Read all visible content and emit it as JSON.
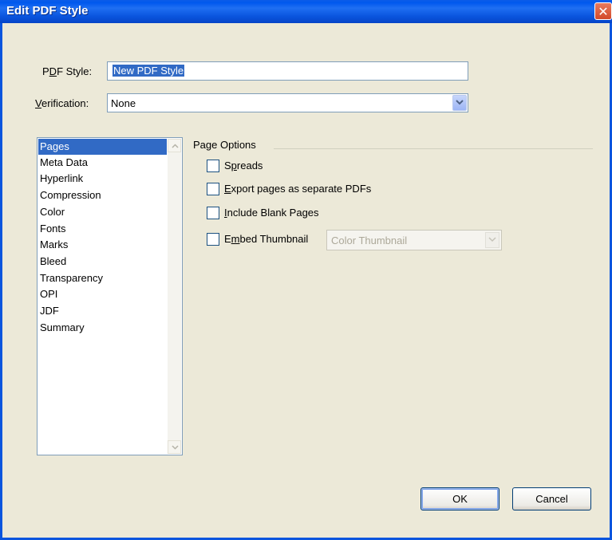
{
  "window": {
    "title": "Edit PDF Style",
    "close_glyph": "✕"
  },
  "pdf_style": {
    "label_prefix": "P",
    "label_u": "D",
    "label_suffix": "F Style:",
    "value": "New PDF Style"
  },
  "verification": {
    "label_u": "V",
    "label_suffix": "erification:",
    "value": "None"
  },
  "sidebar": {
    "items": [
      "Pages",
      "Meta Data",
      "Hyperlink",
      "Compression",
      "Color",
      "Fonts",
      "Marks",
      "Bleed",
      "Transparency",
      "OPI",
      "JDF",
      "Summary"
    ],
    "selected": "Pages"
  },
  "page_options": {
    "title": "Page Options",
    "spreads": {
      "prefix": "S",
      "u": "p",
      "suffix": "reads",
      "checked": false
    },
    "export_separate": {
      "prefix": "",
      "u": "E",
      "suffix": "xport pages as separate PDFs",
      "checked": false
    },
    "include_blank": {
      "prefix": "",
      "u": "I",
      "suffix": "nclude Blank Pages",
      "checked": false
    },
    "embed_thumbnail": {
      "prefix": "E",
      "u": "m",
      "suffix": "bed Thumbnail",
      "checked": false
    },
    "thumbnail_select": {
      "value": "Color Thumbnail",
      "enabled": false
    }
  },
  "buttons": {
    "ok": "OK",
    "cancel": "Cancel"
  },
  "colors": {
    "selection": "#316ac5",
    "titlebar": "#0a5ce8",
    "dialog_bg": "#ece9d8"
  }
}
